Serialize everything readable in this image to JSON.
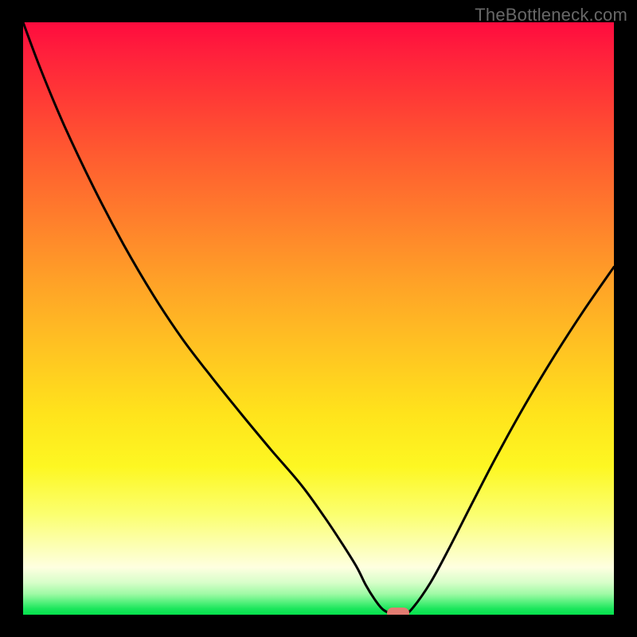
{
  "watermark": "TheBottleneck.com",
  "colors": {
    "curve": "#000000",
    "marker": "#e37c72",
    "background": "#000000",
    "gradient_top": "#ff0b3e",
    "gradient_bottom": "#05e24d"
  },
  "chart_data": {
    "type": "line",
    "title": "",
    "xlabel": "",
    "ylabel": "",
    "xlim": [
      0,
      100
    ],
    "ylim": [
      0,
      100
    ],
    "grid": false,
    "legend": false,
    "x": [
      0,
      3,
      7,
      12,
      17,
      22,
      27,
      32,
      37,
      42,
      47,
      51,
      54,
      56.5,
      58,
      59.5,
      61,
      63,
      64.5,
      66,
      69,
      72,
      76,
      80,
      85,
      90,
      95,
      100
    ],
    "y": [
      100,
      92,
      82.5,
      72,
      62.5,
      54,
      46.5,
      40,
      33.8,
      27.8,
      22,
      16.5,
      12,
      8,
      5,
      2.6,
      0.8,
      0,
      0,
      1.2,
      5.5,
      11,
      18.8,
      26.5,
      35.5,
      43.8,
      51.5,
      58.7
    ],
    "marker": {
      "x": 63.5,
      "y": 0
    }
  }
}
